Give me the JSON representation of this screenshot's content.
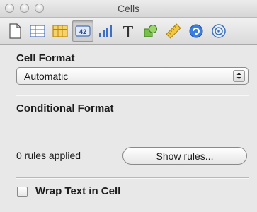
{
  "window": {
    "title": "Cells"
  },
  "toolbar": {
    "tools": [
      {
        "icon": "document-icon"
      },
      {
        "icon": "table-icon"
      },
      {
        "icon": "grid-icon"
      },
      {
        "icon": "cell-format-icon",
        "label": "42",
        "active": true
      },
      {
        "icon": "bar-chart-icon"
      },
      {
        "icon": "text-icon",
        "label": "T"
      },
      {
        "icon": "shapes-icon"
      },
      {
        "icon": "ruler-icon"
      },
      {
        "icon": "link-icon"
      },
      {
        "icon": "spiral-icon"
      }
    ]
  },
  "cell_format": {
    "heading": "Cell Format",
    "selected": "Automatic"
  },
  "conditional_format": {
    "heading": "Conditional Format",
    "status": "0 rules applied",
    "button": "Show rules..."
  },
  "wrap_text": {
    "label": "Wrap Text in Cell",
    "checked": false
  }
}
